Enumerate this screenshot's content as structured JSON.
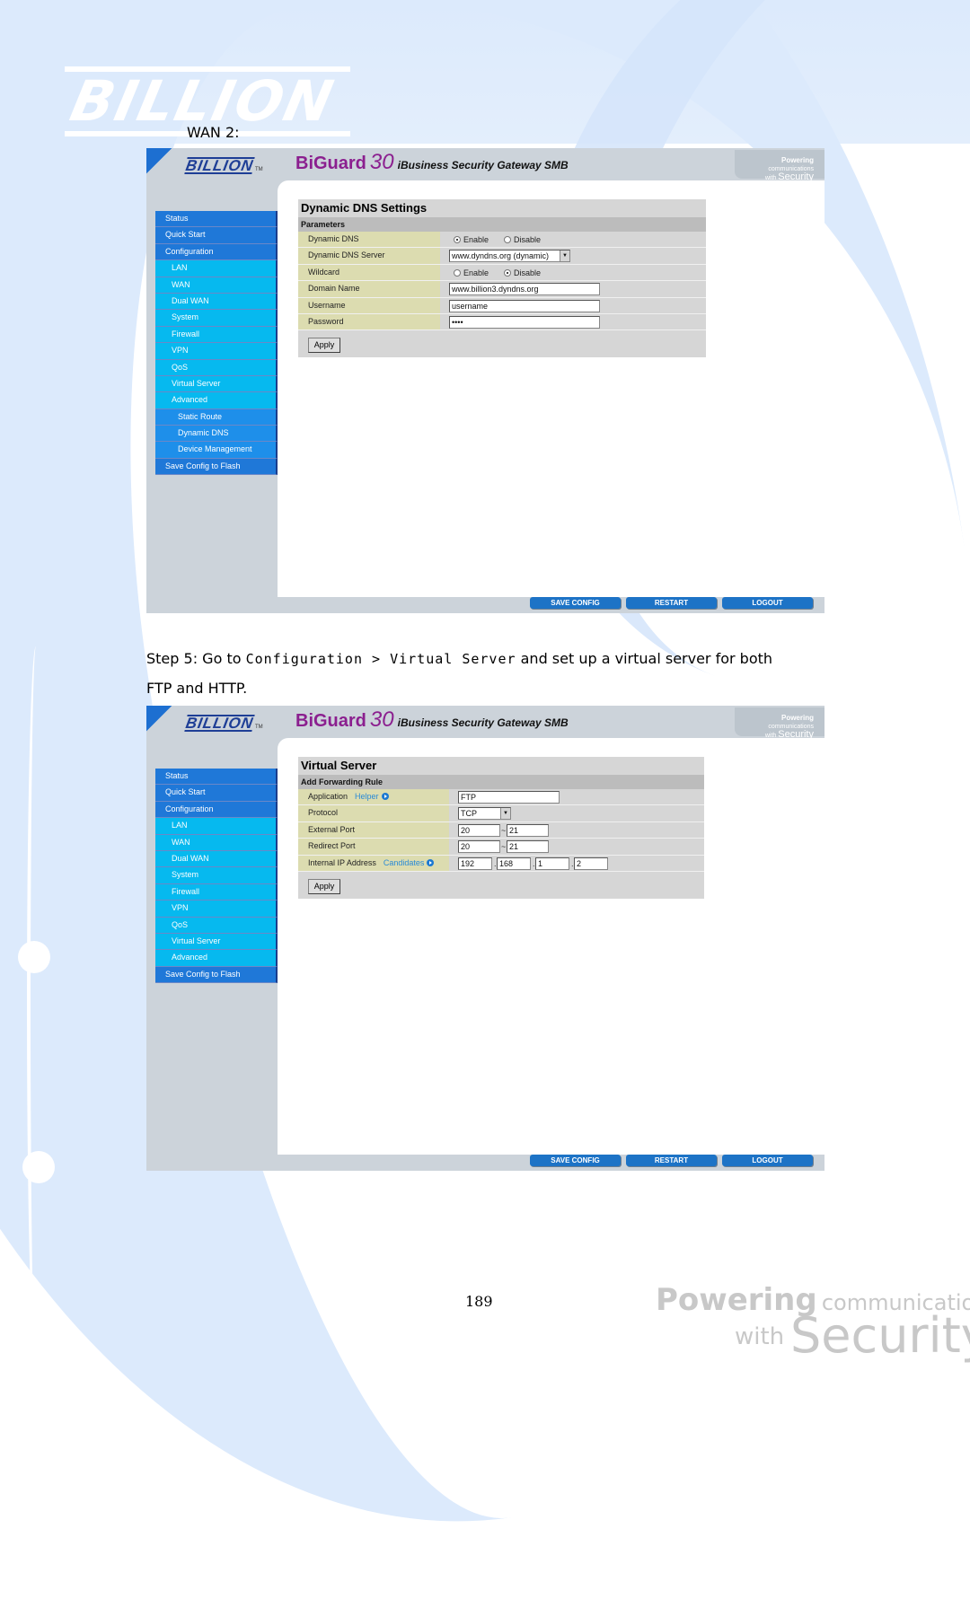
{
  "page": {
    "wan_label": "WAN 2:",
    "step_text": {
      "prefix": "Step 5: Go to ",
      "path1": "Configuration",
      "sep": " > ",
      "path2": "Virtual Server",
      "suffix": " and set up a virtual server for both",
      "line2": "FTP and HTTP."
    },
    "page_number": "189",
    "logo_text": "BILLION",
    "footer_brand": {
      "powering": "Powering",
      "communications": "communications",
      "with": "with",
      "security": "Security"
    }
  },
  "router_ui": {
    "logo": "BILLION",
    "logo_tm": "TM",
    "product_name": "BiGuard",
    "product_number": "30",
    "product_subtitle": "iBusiness Security Gateway SMB",
    "tagline": {
      "powering": "Powering",
      "communications": "communications",
      "with": "with",
      "security": "Security"
    },
    "footer_buttons": [
      "SAVE CONFIG",
      "RESTART",
      "LOGOUT"
    ],
    "colors": {
      "menu_top": "#1f78d8",
      "menu_sub": "#06b9ef",
      "menu_sub2": "#1e8fea",
      "label_bg": "#dcdcb0",
      "brand": "#8b1f8f"
    }
  },
  "screen1": {
    "menu": [
      {
        "label": "Status",
        "level": 1
      },
      {
        "label": "Quick Start",
        "level": 1
      },
      {
        "label": "Configuration",
        "level": 1
      },
      {
        "label": "LAN",
        "level": 2
      },
      {
        "label": "WAN",
        "level": 2
      },
      {
        "label": "Dual WAN",
        "level": 2
      },
      {
        "label": "System",
        "level": 2
      },
      {
        "label": "Firewall",
        "level": 2
      },
      {
        "label": "VPN",
        "level": 2
      },
      {
        "label": "QoS",
        "level": 2
      },
      {
        "label": "Virtual Server",
        "level": 2
      },
      {
        "label": "Advanced",
        "level": 2
      },
      {
        "label": "Static Route",
        "level": 3
      },
      {
        "label": "Dynamic DNS",
        "level": 3
      },
      {
        "label": "Device Management",
        "level": 3
      },
      {
        "label": "Save Config to Flash",
        "level": 1
      }
    ],
    "title": "Dynamic DNS Settings",
    "section": "Parameters",
    "fields": {
      "dynamic_dns": {
        "label": "Dynamic DNS",
        "options": [
          "Enable",
          "Disable"
        ],
        "selected": "Enable"
      },
      "server": {
        "label": "Dynamic DNS Server",
        "value": "www.dyndns.org (dynamic)"
      },
      "wildcard": {
        "label": "Wildcard",
        "options": [
          "Enable",
          "Disable"
        ],
        "selected": "Disable"
      },
      "domain": {
        "label": "Domain Name",
        "value": "www.billion3.dyndns.org"
      },
      "username": {
        "label": "Username",
        "value": "username"
      },
      "password": {
        "label": "Password",
        "value": "••••"
      }
    },
    "apply": "Apply"
  },
  "screen2": {
    "menu": [
      {
        "label": "Status",
        "level": 1
      },
      {
        "label": "Quick Start",
        "level": 1
      },
      {
        "label": "Configuration",
        "level": 1
      },
      {
        "label": "LAN",
        "level": 2
      },
      {
        "label": "WAN",
        "level": 2
      },
      {
        "label": "Dual WAN",
        "level": 2
      },
      {
        "label": "System",
        "level": 2
      },
      {
        "label": "Firewall",
        "level": 2
      },
      {
        "label": "VPN",
        "level": 2
      },
      {
        "label": "QoS",
        "level": 2
      },
      {
        "label": "Virtual Server",
        "level": 2
      },
      {
        "label": "Advanced",
        "level": 2
      },
      {
        "label": "Save Config to Flash",
        "level": 1
      }
    ],
    "title": "Virtual Server",
    "section": "Add Forwarding Rule",
    "fields": {
      "application": {
        "label": "Application",
        "link": "Helper",
        "value": "FTP"
      },
      "protocol": {
        "label": "Protocol",
        "value": "TCP"
      },
      "external_port": {
        "label": "External Port",
        "from": "20",
        "to": "21",
        "sep": "~"
      },
      "redirect_port": {
        "label": "Redirect Port",
        "from": "20",
        "to": "21",
        "sep": "~"
      },
      "internal_ip": {
        "label": "Internal IP Address",
        "link": "Candidates",
        "octets": [
          "192",
          "168",
          "1",
          "2"
        ],
        "sep": "."
      }
    },
    "apply": "Apply"
  }
}
